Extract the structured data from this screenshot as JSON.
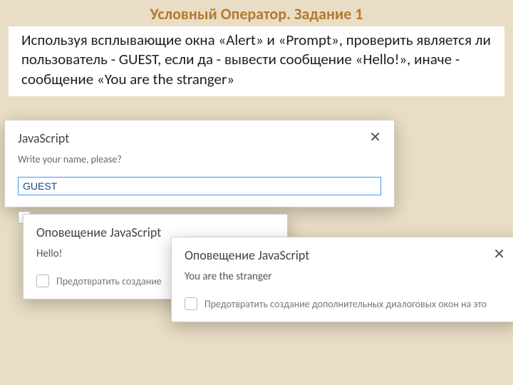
{
  "title": "Условный Оператор. Задание 1",
  "task_text": "Используя всплывающие окна «Alert» и «Prompt», проверить является ли пользователь - GUEST, если да - вывести сообщение «Hello!», иначе - сообщение «You are the stranger»",
  "dialog1": {
    "header": "JavaScript",
    "prompt_label": "Write your name, please?",
    "input_value": "GUEST"
  },
  "dialog2": {
    "header": "Оповещение JavaScript",
    "message": "Hello!",
    "suppress_label": "Предотвратить создание"
  },
  "dialog3": {
    "header": "Оповещение JavaScript",
    "message": "You are the stranger",
    "suppress_label": "Предотвратить создание дополнительных диалоговых окон на это"
  },
  "close_glyph": "✕"
}
